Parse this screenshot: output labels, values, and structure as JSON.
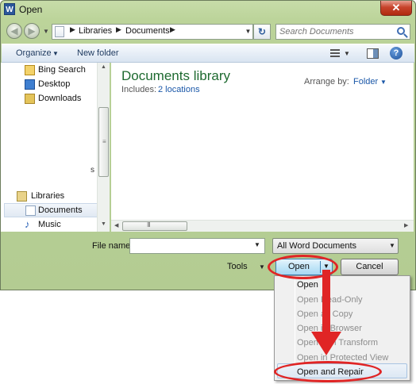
{
  "window": {
    "title": "Open",
    "app_icon": "word-icon",
    "close_label": "✕"
  },
  "nav": {
    "breadcrumbs": [
      "Libraries",
      "Documents"
    ],
    "search_placeholder": "Search Documents"
  },
  "toolbar": {
    "organize_label": "Organize",
    "new_folder_label": "New folder"
  },
  "sidebar": {
    "items": [
      {
        "label": "Bing Search",
        "icon": "bing-search-icon"
      },
      {
        "label": "Desktop",
        "icon": "desktop-icon"
      },
      {
        "label": "Downloads",
        "icon": "downloads-icon"
      },
      {
        "label": "Libraries",
        "icon": "libraries-icon"
      },
      {
        "label": "Documents",
        "icon": "documents-icon",
        "selected": true
      },
      {
        "label": "Music",
        "icon": "music-icon"
      }
    ],
    "truncated_text": "s"
  },
  "library": {
    "title": "Documents library",
    "includes_label": "Includes:",
    "locations_link": "2 locations",
    "arrange_label": "Arrange by:",
    "arrange_value": "Folder"
  },
  "footer": {
    "filename_label": "File name:",
    "filename_value": "",
    "filetype_value": "All Word Documents",
    "tools_label": "Tools",
    "open_label": "Open",
    "cancel_label": "Cancel"
  },
  "open_menu": {
    "items": [
      {
        "label": "Open",
        "enabled": true
      },
      {
        "label": "Open Read-Only",
        "enabled": false
      },
      {
        "label": "Open as Copy",
        "enabled": false
      },
      {
        "label": "Open in Browser",
        "enabled": false
      },
      {
        "label": "Open with Transform",
        "enabled": false
      },
      {
        "label": "Open in Protected View",
        "enabled": false
      },
      {
        "label": "Open and Repair",
        "enabled": true,
        "highlighted": true
      }
    ]
  },
  "annotation": {
    "color": "#e02525"
  },
  "colors": {
    "frame": "#bcd49a",
    "library_title": "#1e6a30",
    "link": "#1a57a8"
  }
}
